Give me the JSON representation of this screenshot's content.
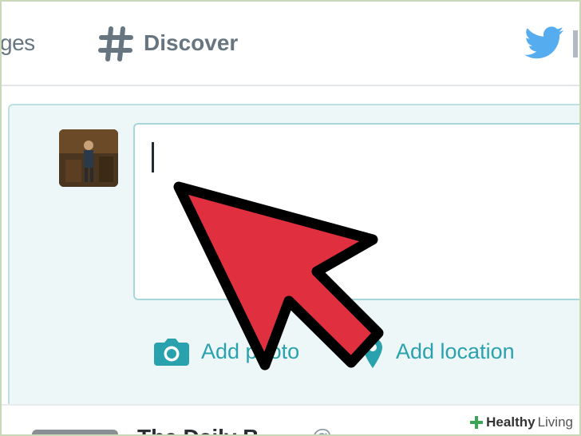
{
  "nav": {
    "messages_label": "ges",
    "discover_label": "Discover",
    "hash_icon": "hashtag-icon",
    "brand_icon": "twitter-bird-icon"
  },
  "composer": {
    "text_value": "",
    "add_photo_label": "Add photo",
    "add_location_label": "Add location",
    "camera_icon": "camera-icon",
    "location_icon": "map-pin-icon"
  },
  "feed": {
    "first_name": "The Daily B..",
    "first_handle": "@... "
  },
  "watermark": {
    "healthy": "Healthy",
    "living": "Living"
  },
  "colors": {
    "twitter_blue": "#55acee",
    "teal": "#2aa2ad",
    "arrow_red": "#e0303f",
    "nav_gray": "#66757f"
  }
}
